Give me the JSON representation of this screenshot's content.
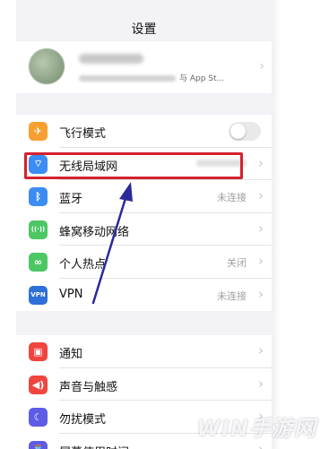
{
  "nav": {
    "title": "设置"
  },
  "profile": {
    "subtitle_suffix": "与 App St..."
  },
  "group1": [
    {
      "label": "飞行模式",
      "icon": "airplane-icon",
      "color": "#f7a031",
      "glyph": "✈",
      "control": "toggle",
      "toggle_on": false
    },
    {
      "label": "无线局域网",
      "icon": "wifi-icon",
      "color": "#3b8cf3",
      "glyph": "⌔",
      "control": "blurred-value"
    },
    {
      "label": "蓝牙",
      "icon": "bluetooth-icon",
      "color": "#3b8cf3",
      "glyph": "ᛒ",
      "value": "未连接"
    },
    {
      "label": "蜂窝移动网络",
      "icon": "cellular-icon",
      "color": "#4cc764",
      "glyph": "((·))",
      "value": ""
    },
    {
      "label": "个人热点",
      "icon": "hotspot-icon",
      "color": "#4cc764",
      "glyph": "∞",
      "value": "关闭"
    },
    {
      "label": "VPN",
      "icon": "vpn-icon",
      "color": "#2f6fd8",
      "glyph": "VPN",
      "value": "未连接"
    }
  ],
  "group2": [
    {
      "label": "通知",
      "icon": "notifications-icon",
      "color": "#f0453f",
      "glyph": "▣"
    },
    {
      "label": "声音与触感",
      "icon": "sound-icon",
      "color": "#f0453f",
      "glyph": "◀)"
    },
    {
      "label": "勿扰模式",
      "icon": "moon-icon",
      "color": "#5e5ce6",
      "glyph": "☾"
    },
    {
      "label": "屏幕使用时间",
      "icon": "hourglass-icon",
      "color": "#5e5ce6",
      "glyph": "⌛"
    }
  ],
  "watermark": "WIN手游网",
  "annotation": {
    "highlight_color": "#d5212e",
    "arrow_color": "#2b2a9a"
  }
}
